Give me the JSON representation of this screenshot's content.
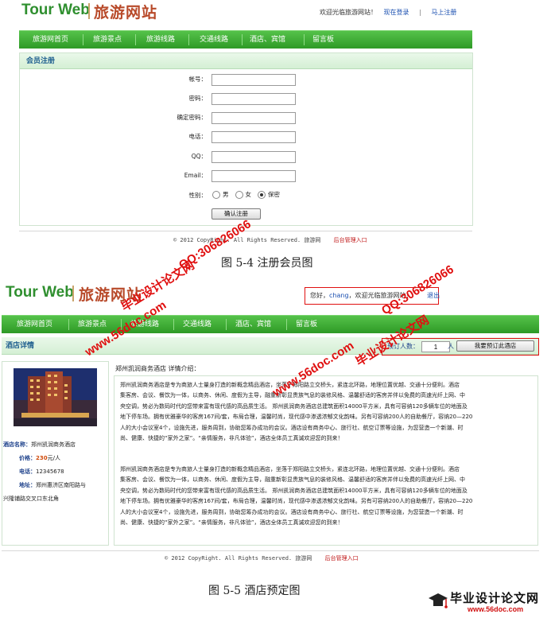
{
  "screen1": {
    "logo_en": "Tour Web",
    "logo_cn": "旅游网站",
    "welcome": "欢迎光临旅游网站！",
    "login_link": "现在登录",
    "sep": "|",
    "register_link": "马上注册",
    "nav": [
      "旅游网首页",
      "旅游景点",
      "旅游线路",
      "交通线路",
      "酒店、宾馆",
      "留言板"
    ],
    "section_title": "会员注册",
    "fields": [
      {
        "label": "帐号：",
        "value": ""
      },
      {
        "label": "密码：",
        "value": ""
      },
      {
        "label": "确定密码：",
        "value": ""
      },
      {
        "label": "电话：",
        "value": ""
      },
      {
        "label": "QQ：",
        "value": ""
      },
      {
        "label": "Email：",
        "value": ""
      }
    ],
    "gender_label": "性别：",
    "gender_options": [
      "男",
      "女",
      "保密"
    ],
    "gender_selected": "保密",
    "submit": "确认注册",
    "footer_copy": "© 2012 CopyRight. All Rights Reserved. 旅游网",
    "footer_admin": "后台管理入口",
    "caption": "图 5-4  注册会员图"
  },
  "screen2": {
    "logo_en": "Tour Web",
    "logo_cn": "旅游网站",
    "greeting_pre": "您好，",
    "username": "chang",
    "greeting_post": "，欢迎光临旅游网站！",
    "logout": "退出",
    "nav": [
      "旅游网首页",
      "旅游景点",
      "旅游线路",
      "交通线路",
      "酒店、宾馆",
      "留言板"
    ],
    "section_title": "酒店详情",
    "booking_label": "预订人数：",
    "booking_value": "1",
    "booking_unit": "人",
    "booking_button": "我要预订此酒店",
    "hotel_heading": "郑州凯润商务酒店 详情介绍：",
    "description_lines": [
      "郑州凯润商务酒店是专为商旅人士量身打造的新概念精品酒店，坐落于郑阳路立交桥头，紧连北环路，地理位置优越、交通十分便利。酒店",
      "集客房、会议、餐饮为一体，以商务、休闲、度假为主导，融重新彰显贵族气息的装修风格、温馨舒适的客房并伴以免费的高速光纤上网、中",
      "央空调，势必为数码时代的您带来富有现代感的高品质生活。 郑州凯润商务酒店总建筑面积14000平方米，具有可容纳120多辆车位的地面及",
      "地下停车场。拥有优雅豪华的客房167间/套，布局合理，温馨时尚，现代感中渗透浓郁文化韵味。另有可容纳200人的自助餐厅，容纳20—220",
      "人的大小会议室4个，设施先进，服务周到，协助您筹办成功的会议。酒店设有商务中心、旅行社、航空订票等设施，为您营造一个新潮、时",
      "尚、健康、快捷的“家外之家”。“亲情服务，非凡体验”，酒店全体员工真诚欢迎您的到来！"
    ],
    "description_lines_2": [
      "郑州凯润商务酒店是专为商旅人士量身打造的新概念精品酒店，坐落于郑阳路立交桥头，紧连北环路，地理位置优越、交通十分便利。酒店",
      "集客房、会议、餐饮为一体，以商务、休闲、度假为主导，融重新彰显贵族气息的装修风格、温馨舒适的客房并伴以免费的高速光纤上网、中",
      "央空调，势必为数码时代的您带来富有现代感的高品质生活。 郑州凯润商务酒店总建筑面积14000平方米，具有可容纳120多辆车位的地面及",
      "地下停车场。拥有优雅豪华的客房167间/套，布局合理，温馨时尚，现代感中渗透浓郁文化韵味。另有可容纳200人的自助餐厅，容纳20—220",
      "人的大小会议室4个，设施先进，服务周到，协助您筹办成功的会议。酒店设有商务中心、旅行社、航空订票等设施，为您营造一个新潮、时",
      "尚、健康、快捷的“家外之家”。“亲情服务，非凡体验”，酒店全体员工真诚欢迎您的到来！"
    ],
    "info": {
      "name_label": "酒店名称：",
      "name_value": "郑州凯润商务酒店",
      "price_label": "价格：",
      "price_value": "230",
      "price_unit": "元/人",
      "phone_label": "电话：",
      "phone_value": "12345678",
      "addr_label": "地址：",
      "addr_value_1": "郑州惠济区南阳路与",
      "addr_value_2": "兴隆铺路交叉口东北角"
    },
    "footer_copy": "© 2012 CopyRight. All Rights Reserved. 旅游网",
    "footer_admin": "后台管理入口",
    "caption": "图 5-5  酒店预定图"
  },
  "watermarks": {
    "site": "www.56doc.com",
    "qq": "QQ:306826066",
    "brand": "毕业设计论文网"
  },
  "corner_logo": {
    "title": "毕业设计论文网",
    "url": "www.56doc.com"
  },
  "colors": {
    "brand_green": "#2e9a26",
    "link_blue": "#1a4fb0",
    "admin_red": "#c01818",
    "watermark_red": "#e01010"
  }
}
